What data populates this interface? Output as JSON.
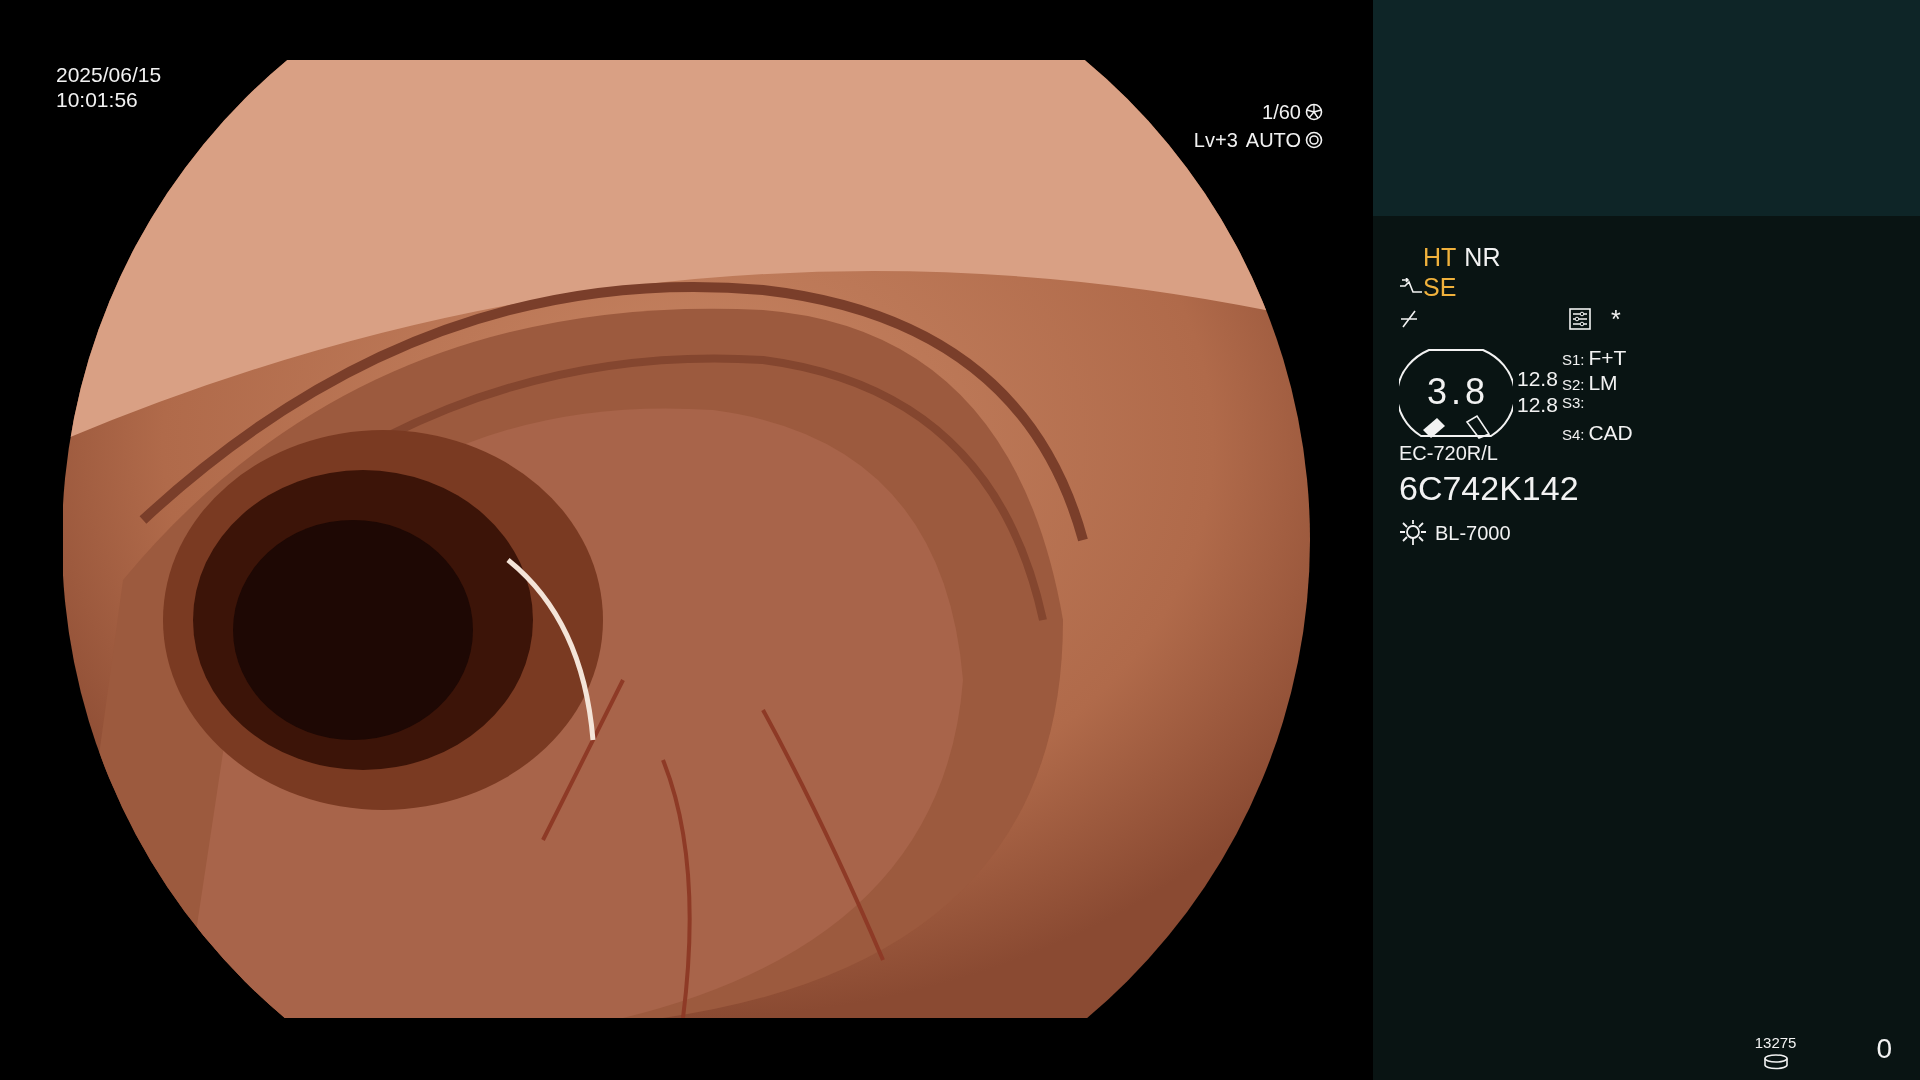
{
  "datetime": {
    "date": "2025/06/15",
    "time": "10:01:56"
  },
  "exposure": {
    "shutter": "1/60",
    "level": "Lv+3",
    "mode": "AUTO"
  },
  "modes": [
    {
      "label": "HT",
      "active": true
    },
    {
      "label": "NR",
      "active": false
    }
  ],
  "structure_enhance": {
    "label": "SE",
    "active": true
  },
  "marker": "*",
  "zoom_gauge": {
    "value": "3.8"
  },
  "readings": [
    "12.8",
    "12.8"
  ],
  "switches": [
    {
      "key": "S1:",
      "value": "F+T"
    },
    {
      "key": "S2:",
      "value": "LM"
    },
    {
      "key": "S3:"
    },
    {
      "key": "S4:",
      "value": "CAD"
    }
  ],
  "scope": {
    "model": "EC-720R/L",
    "serial": "6C742K142"
  },
  "light_source": "BL-7000",
  "counter": "13275",
  "number": "0"
}
